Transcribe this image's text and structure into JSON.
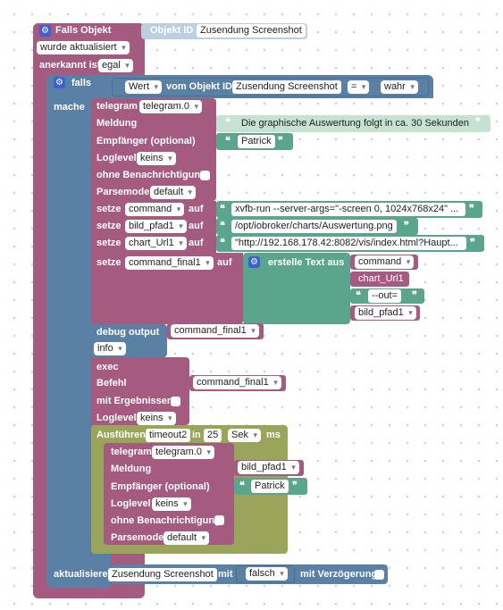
{
  "event_block": {
    "title": "Falls Objekt",
    "object_id_label": "Objekt ID",
    "object_id_value": "Zusendung Screenshot",
    "trigger": "wurde aktualisiert",
    "ack_label": "anerkannt ist",
    "ack_value": "egal"
  },
  "if_block": {
    "label": "falls",
    "do_label": "mache",
    "cond_prop": "Wert",
    "cond_from": "vom Objekt ID",
    "cond_object": "Zusendung Screenshot",
    "cond_op": "=",
    "cond_value": "wahr"
  },
  "telegram1": {
    "label": "telegram",
    "instance": "telegram.0",
    "message_label": "Meldung",
    "message_value": "Die graphische Auswertung folgt in ca. 30 Sekunden",
    "recipient_label": "Empfänger (optional)",
    "recipient_value": "Patrick",
    "loglevel_label": "Loglevel",
    "loglevel_value": "keins",
    "no_notify_label": "ohne Benachrichtigung",
    "parsemode_label": "Parsemode",
    "parsemode_value": "default"
  },
  "set_vars": [
    {
      "set": "setze",
      "var": "command",
      "to": "auf",
      "value": "xvfb-run --server-args=\"-screen 0, 1024x768x24\" ..."
    },
    {
      "set": "setze",
      "var": "bild_pfad1",
      "to": "auf",
      "value": "/opt/iobroker/charts/Auswertung.png"
    },
    {
      "set": "setze",
      "var": "chart_Url1",
      "to": "auf",
      "value": "\"http://192.168.178.42:8082/vis/index.html?Haupt..."
    }
  ],
  "set_final": {
    "set": "setze",
    "var": "command_final1",
    "to": "auf",
    "create_text": "erstelle Text aus",
    "items": [
      "command",
      "chart_Url1",
      "--out=",
      "bild_pfad1"
    ]
  },
  "debug": {
    "label": "debug output",
    "var": "command_final1",
    "level": "info"
  },
  "exec": {
    "label": "exec",
    "command_label": "Befehl",
    "command_var": "command_final1",
    "results_label": "mit Ergebnissen",
    "loglevel_label": "Loglevel",
    "loglevel_value": "keins"
  },
  "timeout": {
    "label": "Ausführen",
    "name": "timeout2",
    "in_label": "in",
    "value": "25",
    "unit": "Sek",
    "ms_label": "ms"
  },
  "telegram2": {
    "label": "telegram",
    "instance": "telegram.0",
    "message_label": "Meldung",
    "message_var": "bild_pfad1",
    "recipient_label": "Empfänger (optional)",
    "recipient_value": "Patrick",
    "loglevel_label": "Loglevel",
    "loglevel_value": "keins",
    "no_notify_label": "ohne Benachrichtigung",
    "parsemode_label": "Parsemode",
    "parsemode_value": "default"
  },
  "update_block": {
    "label": "aktualisiere",
    "object": "Zusendung Screenshot",
    "with_label": "mit",
    "value": "falsch",
    "delay_label": "mit Verzögerung"
  },
  "colors": {
    "event": "#a55b80",
    "logic": "#5b80a5",
    "text": "#5ba58c",
    "timer": "#9aa55b"
  }
}
